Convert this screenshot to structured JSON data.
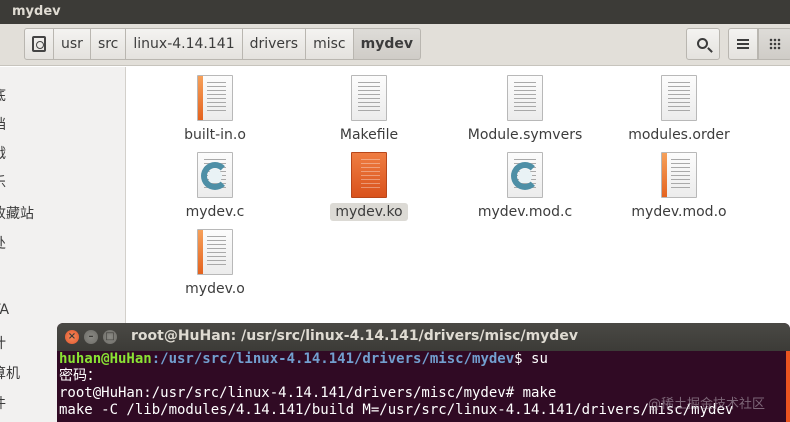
{
  "window": {
    "title": "mydev"
  },
  "pathbar": {
    "crumbs": [
      "usr",
      "src",
      "linux-4.14.141",
      "drivers",
      "misc",
      "mydev"
    ]
  },
  "toolbar": {
    "search_icon": "search-icon",
    "list_view_icon": "list-view-icon",
    "grid_view_icon": "grid-view-icon"
  },
  "sidebar": {
    "items": [
      "底",
      "档",
      "戳",
      "乐",
      "收藏站",
      "处",
      "TA",
      "计",
      "算机",
      "件"
    ]
  },
  "files": [
    {
      "name": "built-in.o",
      "icon": "object-file-icon"
    },
    {
      "name": "Makefile",
      "icon": "text-file-icon"
    },
    {
      "name": "Module.symvers",
      "icon": "text-file-icon"
    },
    {
      "name": "modules.order",
      "icon": "text-file-icon"
    },
    {
      "name": "mydev.c",
      "icon": "c-source-icon"
    },
    {
      "name": "mydev.ko",
      "icon": "kernel-module-icon",
      "selected": true
    },
    {
      "name": "mydev.mod.c",
      "icon": "c-source-icon"
    },
    {
      "name": "mydev.mod.o",
      "icon": "object-file-icon"
    },
    {
      "name": "mydev.o",
      "icon": "object-file-icon"
    }
  ],
  "terminal": {
    "title": "root@HuHan: /usr/src/linux-4.14.141/drivers/misc/mydev",
    "line1": {
      "user": "huhan@HuHan",
      "path": ":/usr/src/linux-4.14.141/drivers/misc/mydev",
      "cmd": "$ su"
    },
    "line2": "密码：",
    "line3": "root@HuHan:/usr/src/linux-4.14.141/drivers/misc/mydev# make",
    "line4": "make -C /lib/modules/4.14.141/build M=/usr/src/linux-4.14.141/drivers/misc/mydev"
  },
  "watermark": "@稀土掘金技术社区",
  "colors": {
    "accent": "#e95420",
    "terminal_bg": "#300a24",
    "prompt_user": "#8ae234",
    "prompt_path": "#729fcf"
  }
}
